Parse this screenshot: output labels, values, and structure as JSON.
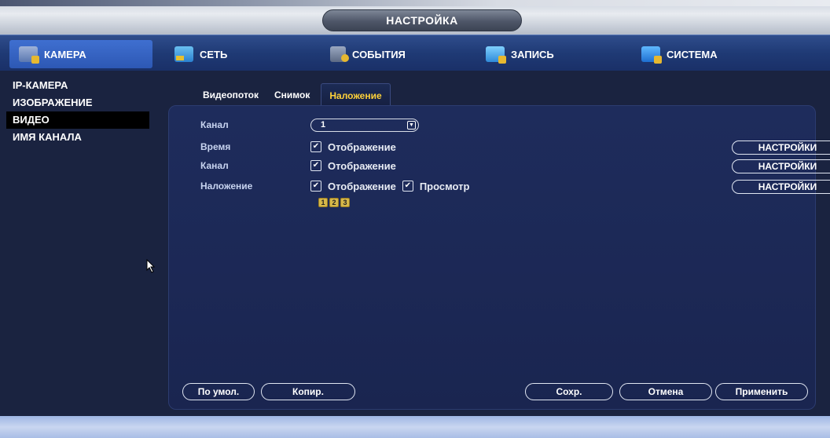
{
  "window": {
    "title": "НАСТРОЙКА"
  },
  "main_tabs": [
    {
      "label": "КАМЕРА",
      "icon": "camera-icon",
      "active": true
    },
    {
      "label": "СЕТЬ",
      "icon": "network-icon",
      "active": false
    },
    {
      "label": "СОБЫТИЯ",
      "icon": "events-icon",
      "active": false
    },
    {
      "label": "ЗАПИСЬ",
      "icon": "record-icon",
      "active": false
    },
    {
      "label": "СИСТЕМА",
      "icon": "system-icon",
      "active": false
    }
  ],
  "sidebar": {
    "items": [
      {
        "label": "IP-КАМЕРА"
      },
      {
        "label": "ИЗОБРАЖЕНИЕ"
      },
      {
        "label": "ВИДЕО",
        "active": true
      },
      {
        "label": "ИМЯ КАНАЛА"
      }
    ]
  },
  "content_tabs": [
    {
      "label": "Видеопоток"
    },
    {
      "label": "Снимок"
    },
    {
      "label": "Наложение",
      "active": true
    }
  ],
  "form": {
    "channel_label": "Канал",
    "channel_value": "1",
    "time_label": "Время",
    "time_display": "Отображение",
    "time_display_checked": true,
    "channel2_label": "Канал",
    "channel2_display": "Отображение",
    "channel2_display_checked": true,
    "overlay_label": "Наложение",
    "overlay_display": "Отображение",
    "overlay_display_checked": true,
    "overlay_preview": "Просмотр",
    "overlay_preview_checked": true,
    "settings_label": "НАСТРОЙКИ",
    "region_buttons": [
      "1",
      "2",
      "3"
    ]
  },
  "bottom_buttons": {
    "default": "По умол.",
    "copy": "Копир.",
    "save": "Сохр.",
    "cancel": "Отмена",
    "apply": "Применить"
  },
  "colors": {
    "accent_active_tab": "#ffd23a",
    "panel_bg": "#1e2c5c",
    "tabbar_bg": "#1f3a75"
  }
}
